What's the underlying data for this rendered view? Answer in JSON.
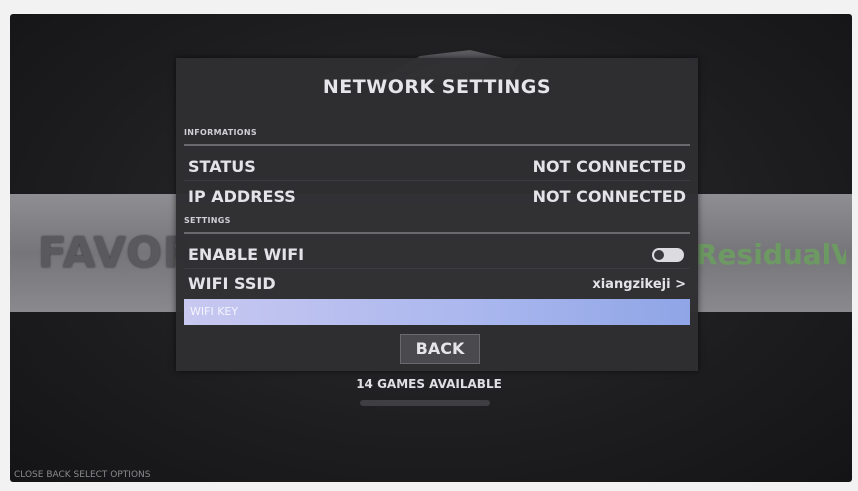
{
  "carousel": {
    "left_system": "FAVORITES",
    "right_system": "ResidualVM"
  },
  "menu": {
    "title": "NETWORK SETTINGS",
    "info_header": "INFORMATIONS",
    "settings_header": "SETTINGS",
    "status_label": "STATUS",
    "status_value": "NOT CONNECTED",
    "ip_label": "IP ADDRESS",
    "ip_value": "NOT CONNECTED",
    "wifi_label": "ENABLE WIFI",
    "wifi_enabled": true,
    "ssid_label": "WIFI SSID",
    "ssid_value": "xiangzikeji",
    "ssid_chevron": ">",
    "key_label": "WIFI KEY",
    "back_label": "BACK"
  },
  "footer": {
    "games_available": "14 GAMES AVAILABLE",
    "help": "CLOSE  BACK  SELECT  OPTIONS"
  },
  "colors": {
    "menu_bg": "#2e2e32",
    "highlight": "#a9b6ee",
    "toggle_on": "#dcdce0"
  }
}
